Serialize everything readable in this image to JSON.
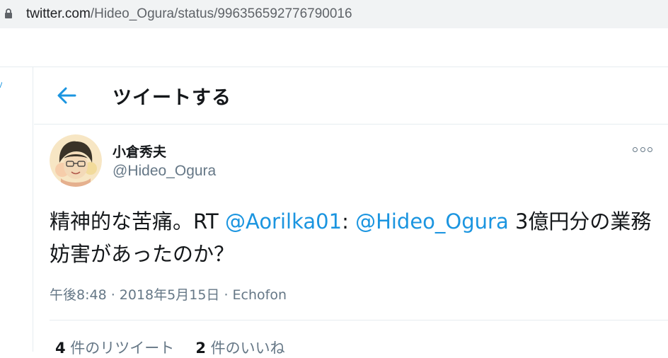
{
  "browser": {
    "url_host": "twitter.com",
    "url_path": "/Hideo_Ogura/status/996356592776790016"
  },
  "header": {
    "title": "ツイートする"
  },
  "tweet": {
    "display_name": "小倉秀夫",
    "handle": "@Hideo_Ogura",
    "text_part1": "精神的な苦痛。RT ",
    "mention1": "@Aorilka01",
    "text_part2": ": ",
    "mention2": "@Hideo_Ogura",
    "text_part3": " 3億円分の業務妨害があったのか？",
    "timestamp": "午後8:48 · 2018年5月15日 · Echofon"
  },
  "stats": {
    "retweet_count": "4",
    "retweet_label": " 件のリツイート",
    "like_count": "2",
    "like_label": " 件のいいね"
  },
  "colors": {
    "accent": "#1b95e0",
    "secondary_text": "#657786",
    "border": "#e6ecf0"
  },
  "icons": [
    "lock-icon",
    "back-arrow-icon",
    "more-options-icon"
  ]
}
